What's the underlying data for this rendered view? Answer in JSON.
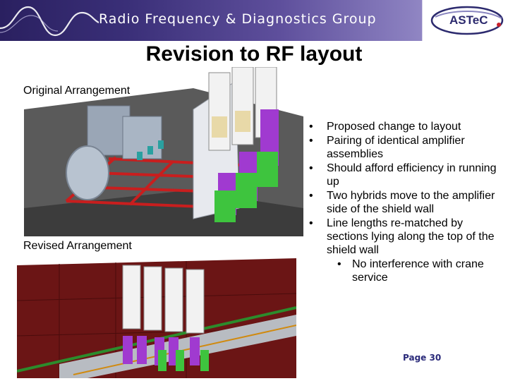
{
  "header": {
    "group_title": "Radio Frequency & Diagnostics Group",
    "logo_text": "ASTeC"
  },
  "slide": {
    "title": "Revision to RF layout",
    "label_original": "Original Arrangement",
    "label_revised": "Revised Arrangement",
    "bullets": [
      "Proposed change to layout",
      "Pairing of identical amplifier assemblies",
      "Should afford efficiency in running up",
      "Two hybrids move to the amplifier side of the shield wall",
      "Line lengths re-matched by sections lying along the top of the shield wall"
    ],
    "sub_bullets": [
      "No interference with crane service"
    ],
    "page": "Page 30"
  },
  "colors": {
    "header_dark": "#2a2060",
    "header_light": "#b5aedb",
    "logo_red": "#c8202a",
    "page_number": "#2a2a7a"
  }
}
